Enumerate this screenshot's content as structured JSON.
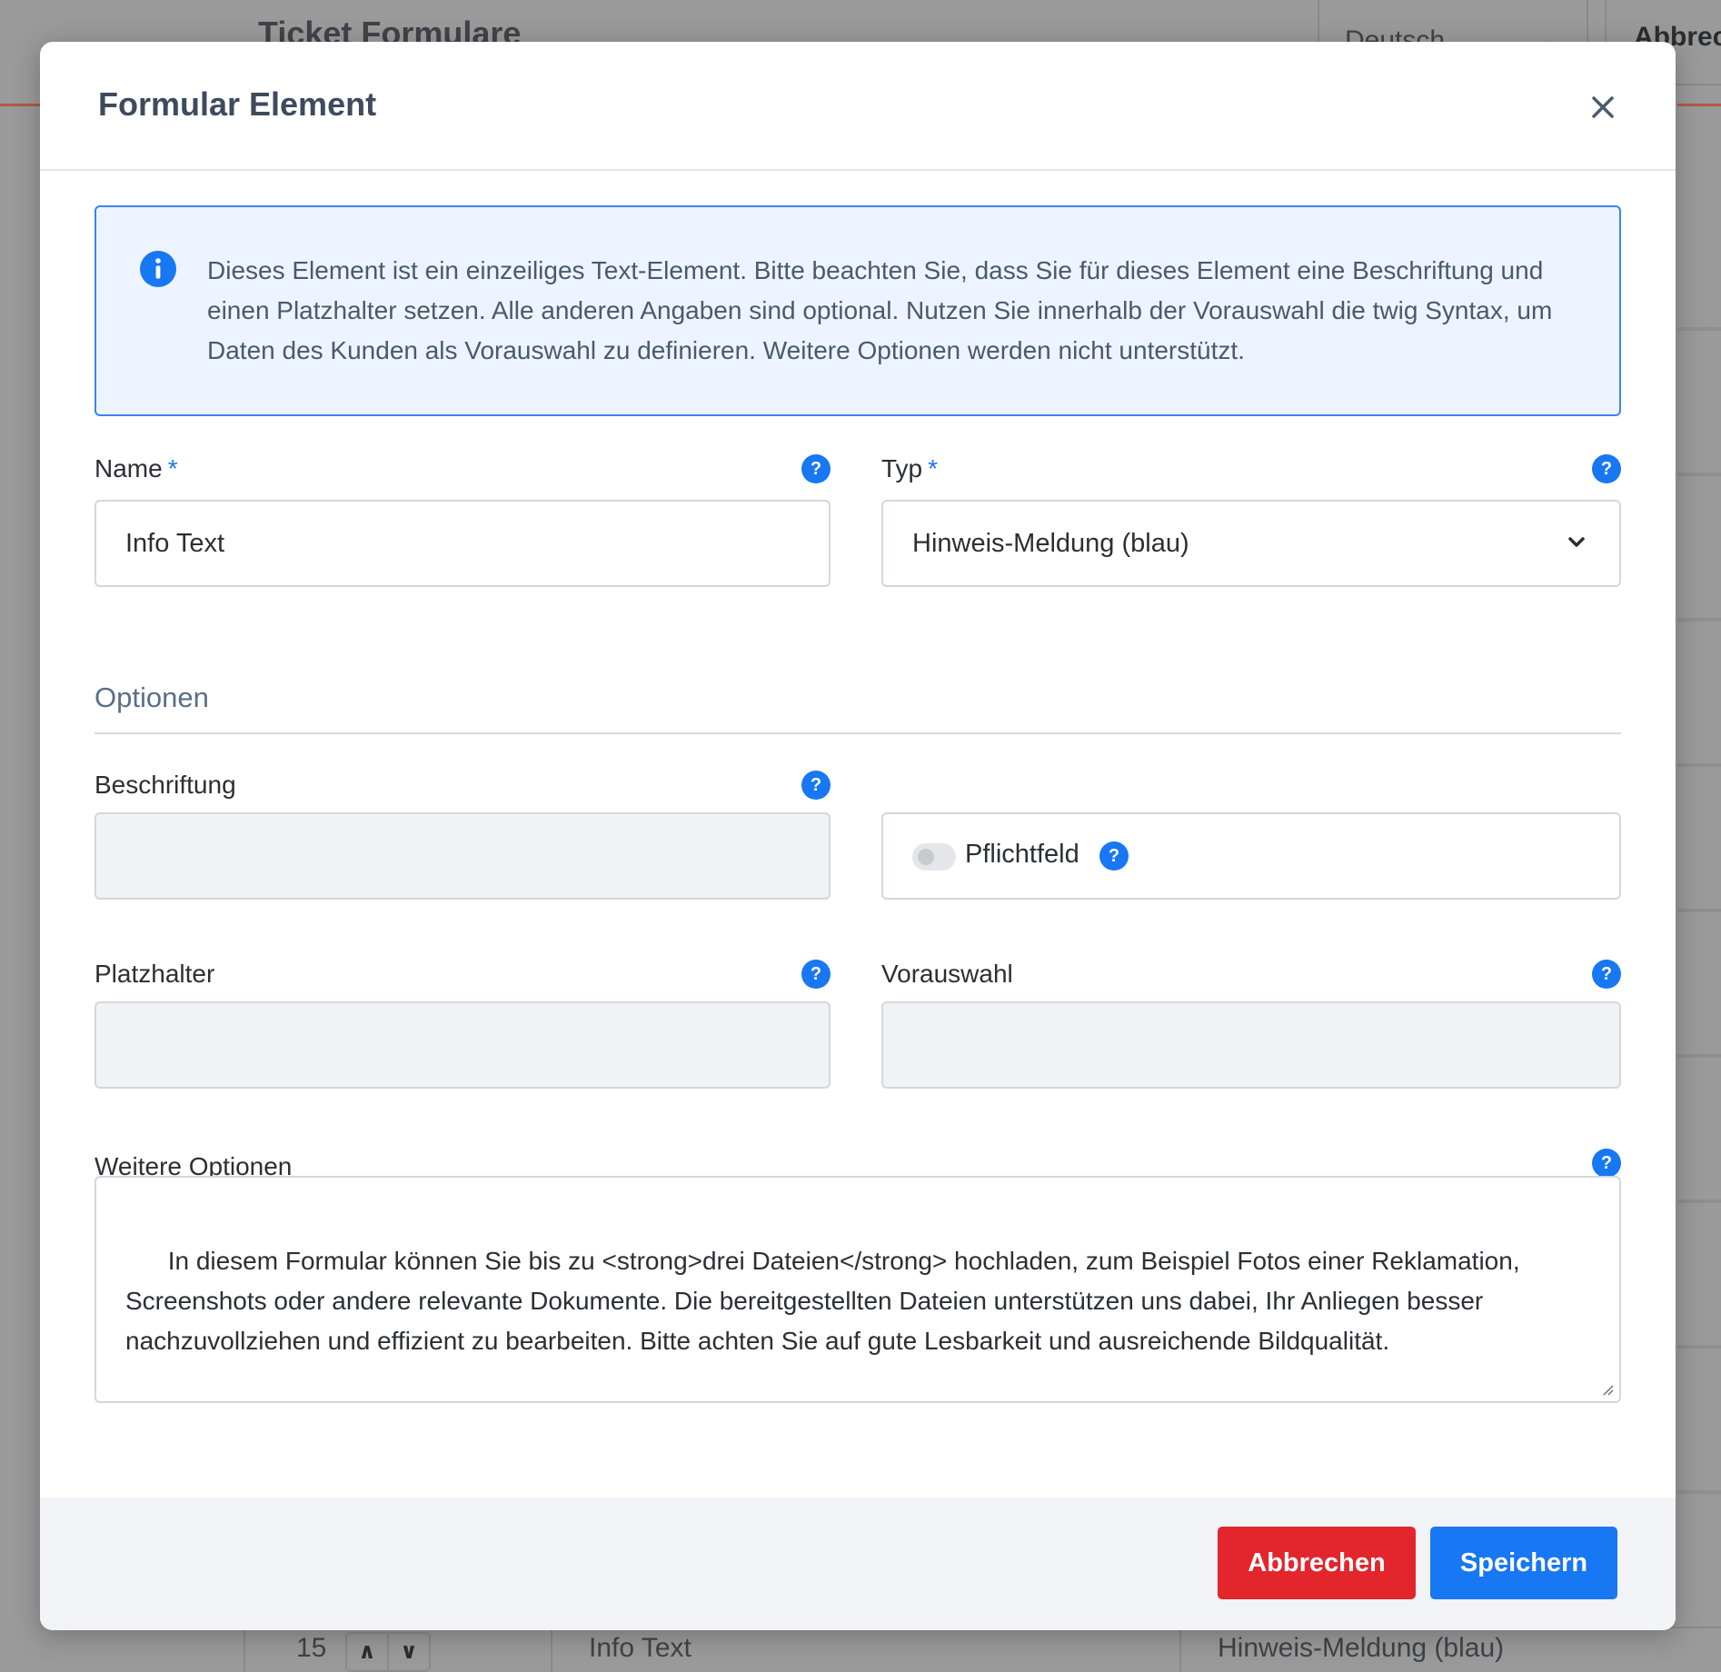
{
  "background": {
    "page_title": "Ticket Formulare",
    "language_select": "Deutsch",
    "cancel_button": "Abbrec",
    "row": {
      "number": "15",
      "name": "Info Text",
      "type": "Hinweis-Meldung (blau)"
    }
  },
  "modal": {
    "title": "Formular Element",
    "info_text": "Dieses Element ist ein einzeiliges Text-Element. Bitte beachten Sie, dass Sie für dieses Element eine Beschriftung und einen Platzhalter setzen. Alle anderen Angaben sind optional. Nutzen Sie innerhalb der Vorauswahl die twig Syntax, um Daten des Kunden als Vorauswahl zu definieren. Weitere Optionen werden nicht unterstützt.",
    "name": {
      "label": "Name",
      "required_mark": "*",
      "value": "Info Text"
    },
    "type": {
      "label": "Typ",
      "required_mark": "*",
      "value": "Hinweis-Meldung (blau)"
    },
    "options_section": "Optionen",
    "caption": {
      "label": "Beschriftung",
      "value": ""
    },
    "required_toggle": {
      "label": "Pflichtfeld",
      "checked": false
    },
    "placeholder": {
      "label": "Platzhalter",
      "value": ""
    },
    "preselection": {
      "label": "Vorauswahl",
      "value": ""
    },
    "more_options": {
      "label": "Weitere Optionen",
      "value": "In diesem Formular können Sie bis zu <strong>drei Dateien</strong> hochladen, zum Beispiel Fotos einer Reklamation, Screenshots oder andere relevante Dokumente. Die bereitgestellten Dateien unterstützen uns dabei, Ihr Anliegen besser nachzuvollziehen und effizient zu bearbeiten. Bitte achten Sie auf gute Lesbarkeit und ausreichende Bildqualität."
    },
    "help_glyph": "?",
    "footer": {
      "cancel_label": "Abbrechen",
      "save_label": "Speichern"
    }
  },
  "colors": {
    "primary": "#1877f2",
    "danger": "#e3262c",
    "info_background": "#edf4ff",
    "overlay": "#9a9a9a"
  },
  "icons": [
    "info-icon",
    "close-icon",
    "help-icon",
    "chevron-down-icon",
    "resize-handle-icon"
  ]
}
